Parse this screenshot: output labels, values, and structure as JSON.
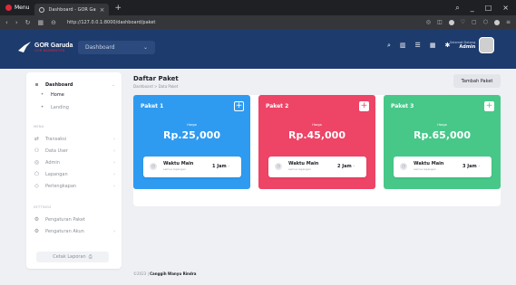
{
  "browser": {
    "menu_label": "Menu",
    "tab_title": "Dashboard - GOR Garuda",
    "tab_close": "×",
    "new_tab": "+",
    "url": "http://127.0.0.1:8000/dashboard/paket",
    "window_min": "_",
    "window_max": "□",
    "window_close": "×"
  },
  "header": {
    "brand_name": "GOR Garuda",
    "brand_sub": "GOR BADMINTON",
    "dropdown_label": "Dashboard",
    "user_greeting": "Selamat Datang",
    "user_name": "Admin"
  },
  "sidebar": {
    "dashboard_label": "Dashboard",
    "sub_items": [
      "Home",
      "Landing"
    ],
    "menu_caption": "MENU",
    "menu_items": [
      "Transaksi",
      "Data User",
      "Admin",
      "Lapangan",
      "Perlengkapan"
    ],
    "settings_caption": "SETTINGS",
    "settings_items": [
      "Pengaturan Paket",
      "Pengaturan Akun"
    ],
    "logout_label": "Cetak Laporan"
  },
  "main": {
    "page_title": "Daftar Paket",
    "breadcrumb": "Dashboard > Data Paket",
    "add_button": "Tambah Paket",
    "price_label": "Harga",
    "wm_title": "Waktu Main",
    "wm_sub": "semua lapangan",
    "cards": [
      {
        "name": "Paket 1",
        "price": "Rp.25,000",
        "duration": "1 Jam",
        "color": "#2f9bf0"
      },
      {
        "name": "Paket 2",
        "price": "Rp.45,000",
        "duration": "2 Jam",
        "color": "#ee4466"
      },
      {
        "name": "Paket 3",
        "price": "Rp.65,000",
        "duration": "3 Jam",
        "color": "#47c889"
      }
    ],
    "footer_year": "©2023",
    "footer_name": "Canggih Wanyu Rindra"
  }
}
